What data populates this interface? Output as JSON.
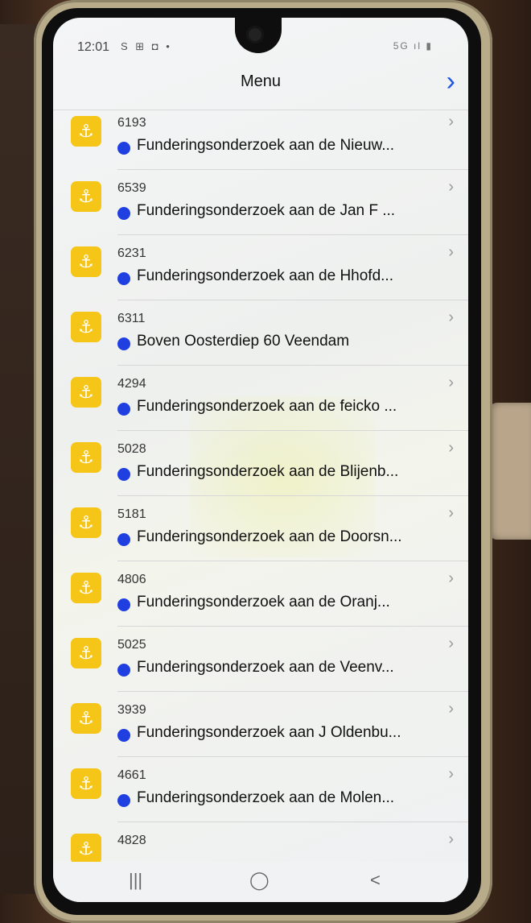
{
  "status_bar": {
    "time": "12:01",
    "left_icons": "S ⊞ ◘ •",
    "right_icons": "5G ıl ▮"
  },
  "header": {
    "title": "Menu",
    "next_icon": "chevron-right-icon"
  },
  "items": [
    {
      "number": "6193",
      "label": "Funderingsonderzoek aan de Nieuw..."
    },
    {
      "number": "6539",
      "label": "Funderingsonderzoek aan de Jan F ..."
    },
    {
      "number": "6231",
      "label": "Funderingsonderzoek aan de Hhofd..."
    },
    {
      "number": "6311",
      "label": "Boven Oosterdiep 60 Veendam"
    },
    {
      "number": "4294",
      "label": "Funderingsonderzoek aan de feicko ..."
    },
    {
      "number": "5028",
      "label": "Funderingsonderzoek aan de Blijenb..."
    },
    {
      "number": "5181",
      "label": "Funderingsonderzoek aan de Doorsn..."
    },
    {
      "number": "4806",
      "label": "Funderingsonderzoek aan de Oranj..."
    },
    {
      "number": "5025",
      "label": "Funderingsonderzoek aan de Veenv..."
    },
    {
      "number": "3939",
      "label": "Funderingsonderzoek aan J Oldenbu..."
    },
    {
      "number": "4661",
      "label": "Funderingsonderzoek aan de Molen..."
    },
    {
      "number": "4828",
      "label": ""
    }
  ],
  "nav_bar": {
    "recent": "|||",
    "home": "◯",
    "back": "<"
  },
  "colors": {
    "accent": "#1e55e5",
    "badge": "#f5c518",
    "status_dot": "#1f3fe0"
  }
}
